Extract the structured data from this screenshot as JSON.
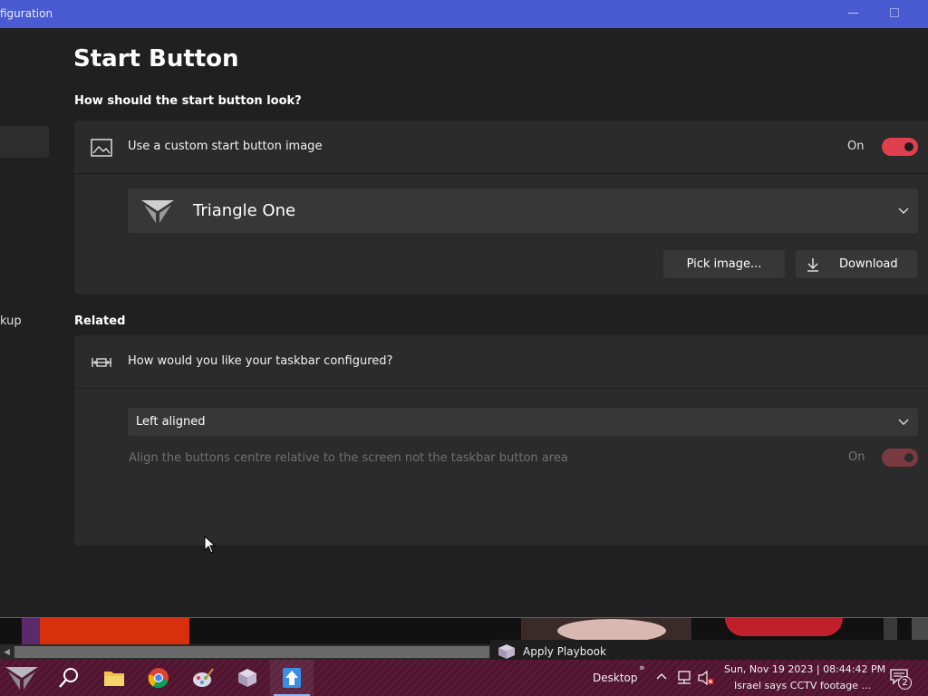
{
  "window": {
    "title": "figuration"
  },
  "sidebar": {
    "partial_item_label": "kup"
  },
  "page": {
    "heading": "Start Button",
    "look_section_title": "How should the start button look?",
    "related_section_title": "Related"
  },
  "custom_image": {
    "label": "Use a custom start button image",
    "state_label": "On",
    "enabled": true,
    "selected_image": "Triangle One",
    "pick_button": "Pick image...",
    "download_button": "Download"
  },
  "taskbar_config": {
    "label": "How would you like your taskbar configured?",
    "selected_alignment": "Left aligned",
    "center_relative_label": "Align the buttons centre relative to the screen not the taskbar button area",
    "center_relative_state_label": "On",
    "center_relative_enabled": true
  },
  "colors": {
    "accent": "#e0404e",
    "titlebar": "#4a5ad0",
    "background": "#202020",
    "card": "#2b2b2b"
  },
  "tooltip": {
    "text": "Apply Playbook"
  },
  "taskbar": {
    "apps": [
      "start-icon",
      "search-icon",
      "file-explorer-icon",
      "chrome-icon",
      "paint-icon",
      "package-icon",
      "configurator-icon"
    ],
    "desktop_label": "Desktop",
    "overflow_label": "»",
    "datetime": "Sun, Nov 19 2023 | 08:44:42 PM",
    "news": "Israel says CCTV footage ...",
    "notification_count": "2"
  }
}
